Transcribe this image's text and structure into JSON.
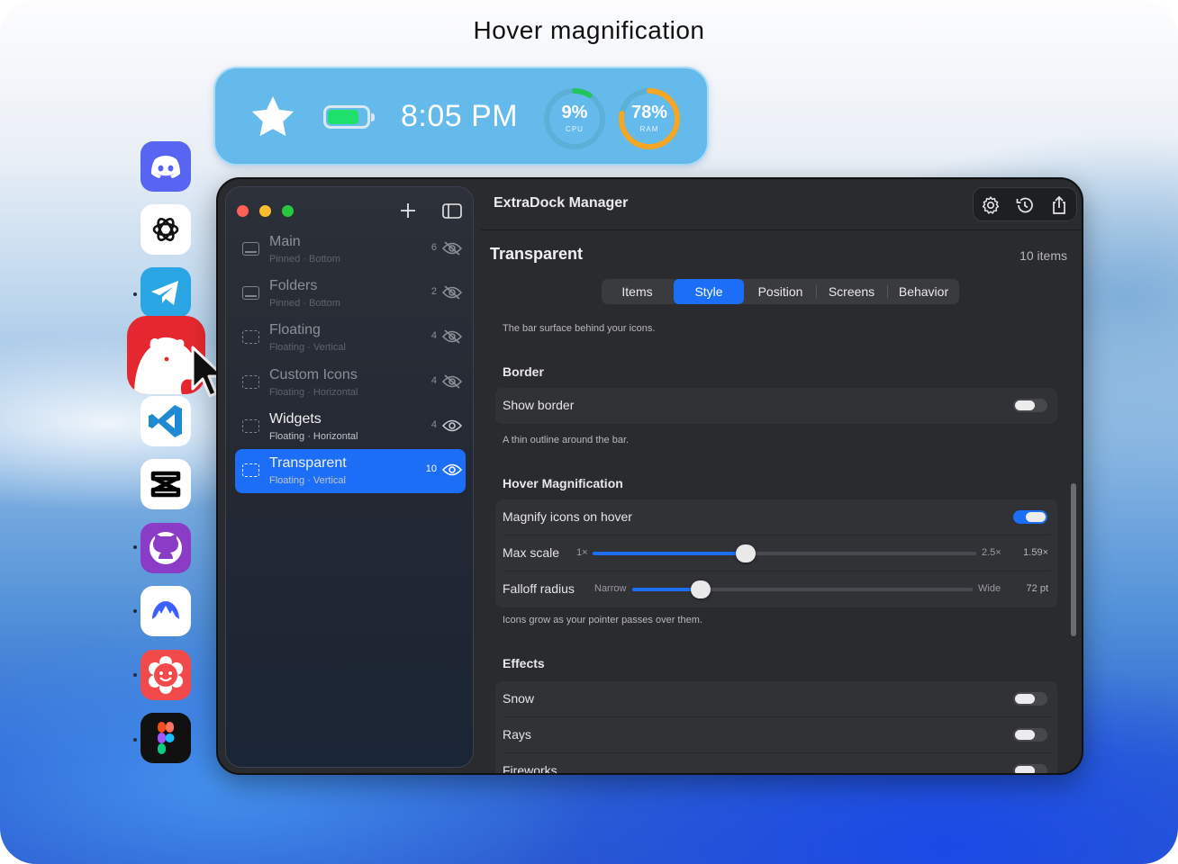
{
  "caption": "Hover magnification",
  "widgets": {
    "time": "8:05 PM",
    "battery_level": 0.82,
    "cpu": {
      "value": "9%",
      "label": "CPU",
      "fraction": 0.09
    },
    "ram": {
      "value": "78%",
      "label": "RAM",
      "fraction": 0.78
    },
    "colors": {
      "bar": "#64baea",
      "battery": "#1ee16c",
      "cpu_ring": "#22c55e",
      "ram_ring": "#f5a623"
    }
  },
  "dock": {
    "apps": [
      "Discord",
      "ChatGPT",
      "Telegram",
      "Bear",
      "Visual Studio Code",
      "CapCut",
      "GitHub Desktop",
      "NordVPN",
      "Flower app",
      "Figma"
    ],
    "hovered": "Bear"
  },
  "window": {
    "title": "ExtraDock Manager",
    "sidebar": {
      "items": [
        {
          "name": "Main",
          "sub": "Pinned · Bottom",
          "count": "6",
          "visible": false
        },
        {
          "name": "Folders",
          "sub": "Pinned · Bottom",
          "count": "2",
          "visible": false
        },
        {
          "name": "Floating",
          "sub": "Floating · Vertical",
          "count": "4",
          "visible": false
        },
        {
          "name": "Custom Icons",
          "sub": "Floating · Horizontal",
          "count": "4",
          "visible": false
        },
        {
          "name": "Widgets",
          "sub": "Floating · Horizontal",
          "count": "4",
          "visible": true
        },
        {
          "name": "Transparent",
          "sub": "Floating · Vertical",
          "count": "10",
          "visible": true
        }
      ],
      "selected": "Transparent"
    },
    "main": {
      "title": "Transparent",
      "count_label": "10 items",
      "tabs": [
        "Items",
        "Style",
        "Position",
        "Screens",
        "Behavior"
      ],
      "selected_tab": "Style",
      "surface_note": "The bar surface behind your icons.",
      "border": {
        "heading": "Border",
        "show_border_label": "Show border",
        "show_border": false,
        "note": "A thin outline around the bar."
      },
      "hover": {
        "heading": "Hover Magnification",
        "magnify_label": "Magnify icons on hover",
        "magnify": true,
        "max_scale": {
          "label": "Max scale",
          "min": "1×",
          "max": "2.5×",
          "value": "1.59×",
          "fraction": 0.4
        },
        "falloff": {
          "label": "Falloff radius",
          "min": "Narrow",
          "max": "Wide",
          "value": "72 pt",
          "fraction": 0.2
        },
        "note": "Icons grow as your pointer passes over them."
      },
      "effects": {
        "heading": "Effects",
        "items": [
          {
            "label": "Snow",
            "on": false
          },
          {
            "label": "Rays",
            "on": false
          },
          {
            "label": "Fireworks",
            "on": false
          }
        ]
      }
    }
  }
}
